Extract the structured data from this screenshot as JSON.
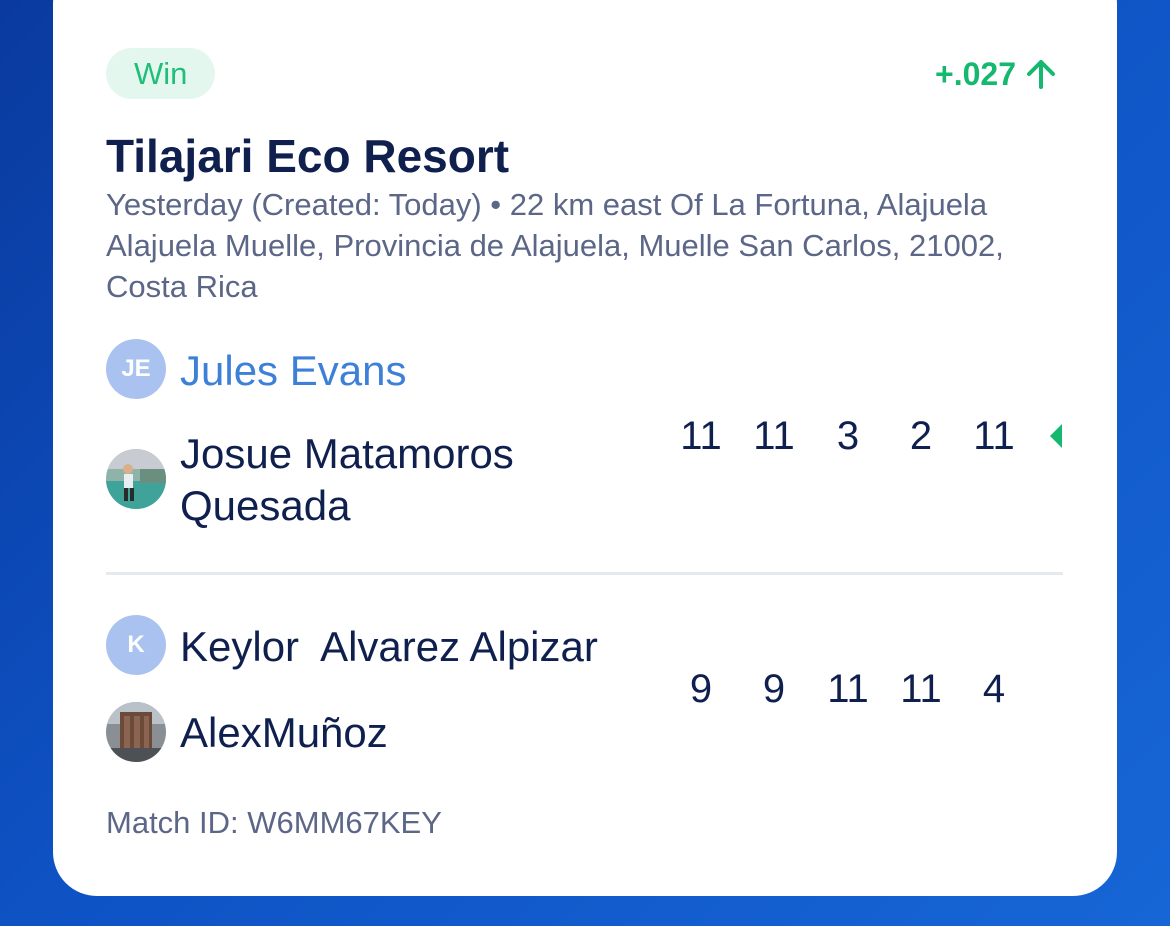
{
  "match": {
    "result": "Win",
    "rating_change": "+.027",
    "rating_change_icon": "arrow-up-icon",
    "accent_color": "#14b86e",
    "venue": "Tilajari Eco Resort",
    "details": "Yesterday (Created: Today) • 22 km east Of La Fortuna, Alajuela Alajuela Muelle, Provincia de Alajuela, Muelle San Carlos, 21002, Costa Rica",
    "match_id": "Match ID: W6MM67KEY"
  },
  "teams": [
    {
      "players": [
        {
          "name": "Jules Evans",
          "avatar_type": "initials",
          "initials": "JE",
          "highlighted": true
        },
        {
          "name": "Josue Matamoros Quesada",
          "avatar_type": "photo",
          "highlighted": false
        }
      ],
      "scores": [
        "11",
        "11",
        "3",
        "2",
        "11"
      ],
      "winner": true
    },
    {
      "players": [
        {
          "name": "Keylor  Alvarez Alpizar",
          "avatar_type": "initials",
          "initials": "K",
          "highlighted": false
        },
        {
          "name": "AlexMuñoz",
          "avatar_type": "photo",
          "highlighted": false
        }
      ],
      "scores": [
        "9",
        "9",
        "11",
        "11",
        "4"
      ],
      "winner": false
    }
  ]
}
